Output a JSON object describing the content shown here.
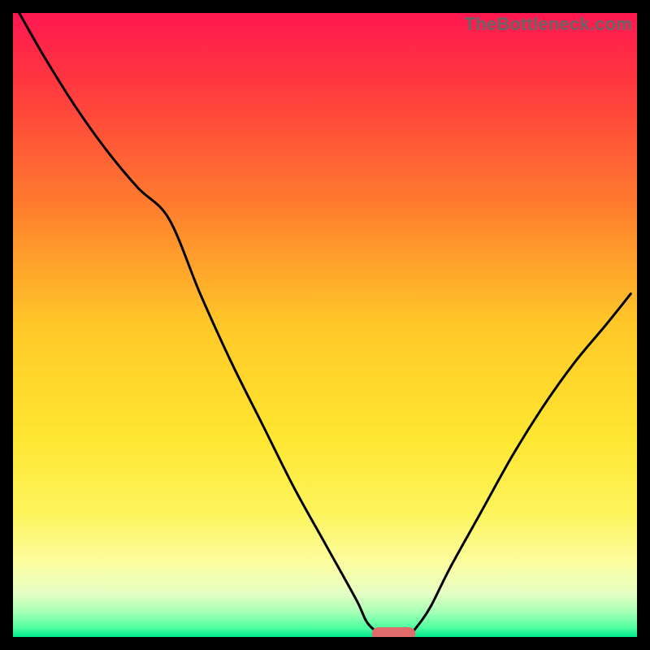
{
  "watermark": "TheBottleneck.com",
  "chart_data": {
    "type": "line",
    "title": "",
    "xlabel": "",
    "ylabel": "",
    "xlim": [
      0,
      100
    ],
    "ylim": [
      0,
      100
    ],
    "grid": false,
    "background": {
      "type": "vertical-gradient",
      "stops": [
        {
          "offset": 0.0,
          "color": "#ff1750"
        },
        {
          "offset": 0.12,
          "color": "#ff3a3f"
        },
        {
          "offset": 0.3,
          "color": "#ff7a2e"
        },
        {
          "offset": 0.5,
          "color": "#ffc828"
        },
        {
          "offset": 0.68,
          "color": "#ffe631"
        },
        {
          "offset": 0.8,
          "color": "#fdf45c"
        },
        {
          "offset": 0.88,
          "color": "#fbfc9e"
        },
        {
          "offset": 0.93,
          "color": "#e6ffc4"
        },
        {
          "offset": 0.96,
          "color": "#a6ffb6"
        },
        {
          "offset": 0.985,
          "color": "#4fffa0"
        },
        {
          "offset": 1.0,
          "color": "#00e88e"
        }
      ]
    },
    "series": [
      {
        "name": "bottleneck-curve",
        "x": [
          1,
          5,
          10,
          15,
          20,
          25,
          30,
          35,
          40,
          45,
          50,
          55,
          57,
          60,
          63,
          65,
          67,
          70,
          75,
          80,
          85,
          90,
          95,
          99
        ],
        "values": [
          100,
          93,
          85,
          78,
          72,
          67,
          55,
          44,
          34,
          24,
          15,
          6,
          2,
          0,
          0,
          2,
          5,
          11,
          20,
          29,
          37,
          44,
          50,
          55
        ]
      }
    ],
    "marker": {
      "name": "optimal-zone",
      "shape": "pill",
      "x_center": 61,
      "y": 0,
      "width_pct": 7,
      "color": "#df6b6b"
    }
  }
}
